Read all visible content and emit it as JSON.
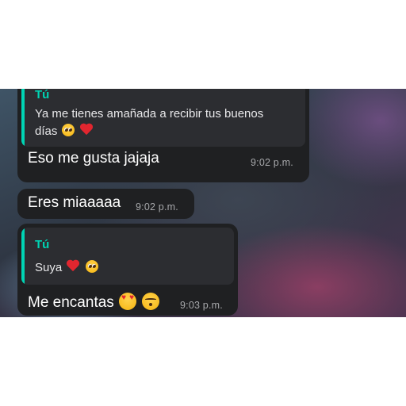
{
  "messages": [
    {
      "reply": {
        "author": "Tú",
        "line1": "Ya me tienes amañada a recibir tus buenos",
        "line2": "días"
      },
      "text": "Eso me gusta jajaja",
      "time": "9:02 p.m."
    },
    {
      "text": "Eres miaaaaa",
      "time": "9:02 p.m."
    },
    {
      "reply": {
        "author": "Tú",
        "line1": "Suya"
      },
      "text": "Me encantas",
      "time": "9:03 p.m."
    }
  ],
  "colors": {
    "bubble": "#1f2022",
    "quote_background": "#2c2d31",
    "quote_accent": "#00d4b4",
    "timestamp": "#a7a8ab"
  },
  "icons": [
    "pleading-face-emoji",
    "red-heart-emoji",
    "heart-eyes-emoji",
    "kissing-face-emoji"
  ]
}
